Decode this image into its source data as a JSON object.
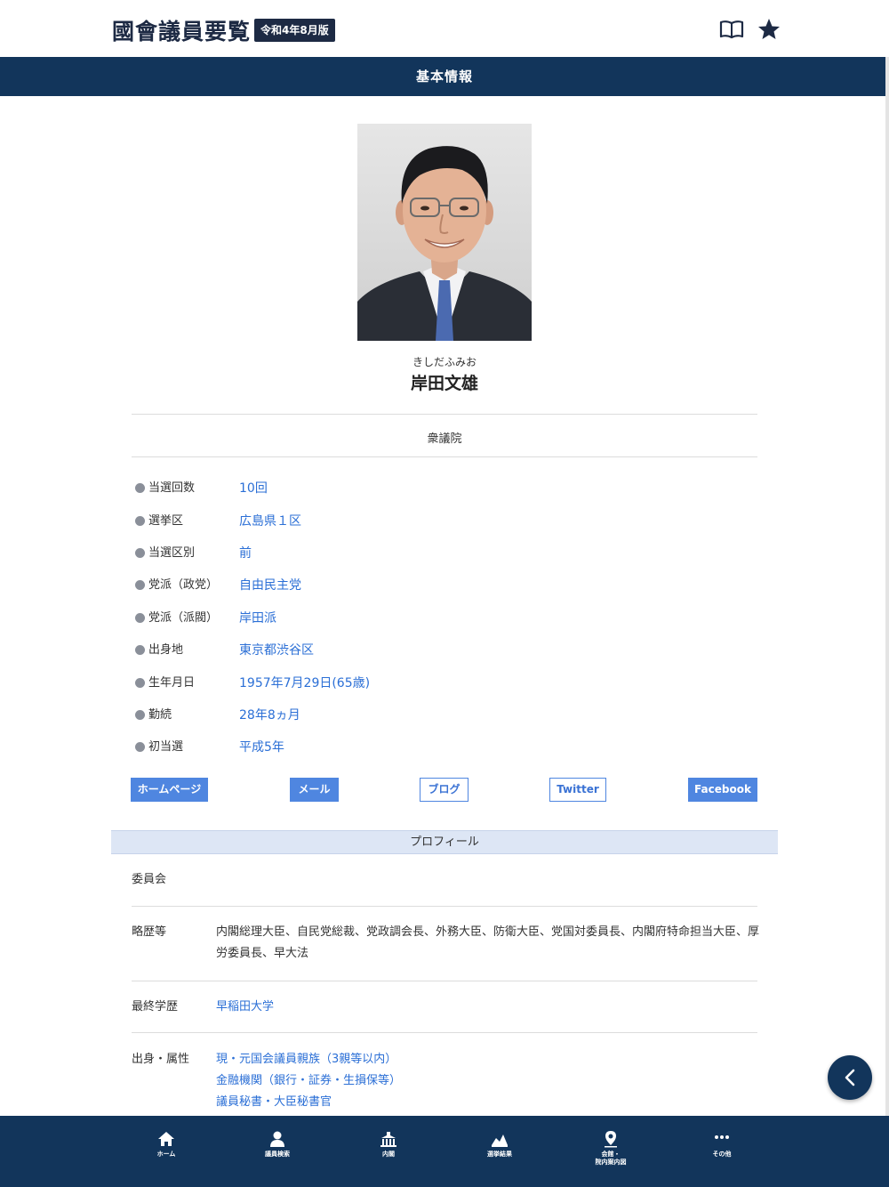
{
  "header": {
    "title": "國會議員要覧",
    "edition": "令和4年8月版",
    "icons": [
      "book-icon",
      "star-icon"
    ]
  },
  "section_title": "基本情報",
  "member": {
    "name_kana": "きしだふみお",
    "name": "岸田文雄",
    "chamber": "衆議院"
  },
  "info": [
    {
      "label": "当選回数",
      "value": "10回"
    },
    {
      "label": "選挙区",
      "value": "広島県１区"
    },
    {
      "label": "当選区別",
      "value": "前"
    },
    {
      "label": "党派（政党）",
      "value": "自由民主党"
    },
    {
      "label": "党派（派閥）",
      "value": "岸田派"
    },
    {
      "label": "出身地",
      "value": "東京都渋谷区"
    },
    {
      "label": "生年月日",
      "value": "1957年7月29日(65歳)"
    },
    {
      "label": "勤続",
      "value": "28年8ヵ月"
    },
    {
      "label": "初当選",
      "value": "平成5年"
    }
  ],
  "links": {
    "homepage": "ホームページ",
    "mail": "メール",
    "blog": "ブログ",
    "twitter": "Twitter",
    "facebook": "Facebook"
  },
  "profile": {
    "title": "プロフィール",
    "committee_label": "委員会",
    "committee_value": "",
    "career_label": "略歴等",
    "career_value": "内閣総理大臣、自民党総裁、党政調会長、外務大臣、防衛大臣、党国対委員長、内閣府特命担当大臣、厚労委員長、早大法",
    "education_label": "最終学歴",
    "education_value": "早稲田大学",
    "attributes_label": "出身・属性",
    "attributes": [
      "現・元国会議員親族（3親等以内）",
      "金融機関（銀行・証券・生損保等）",
      "議員秘書・大臣秘書官"
    ]
  },
  "nav": [
    {
      "label": "ホーム",
      "icon": "home-icon"
    },
    {
      "label": "議員検索",
      "icon": "person-icon"
    },
    {
      "label": "内閣",
      "icon": "building-icon"
    },
    {
      "label": "選挙結果",
      "icon": "chart-icon"
    },
    {
      "label": "会館・",
      "label2": "院内案内図",
      "icon": "map-pin-icon"
    },
    {
      "label": "その他",
      "icon": "more-icon"
    }
  ],
  "colors": {
    "navy": "#12355b",
    "link_blue": "#2b6fd6",
    "button_blue": "#4f86e0",
    "profile_bar": "#dde6f5"
  }
}
